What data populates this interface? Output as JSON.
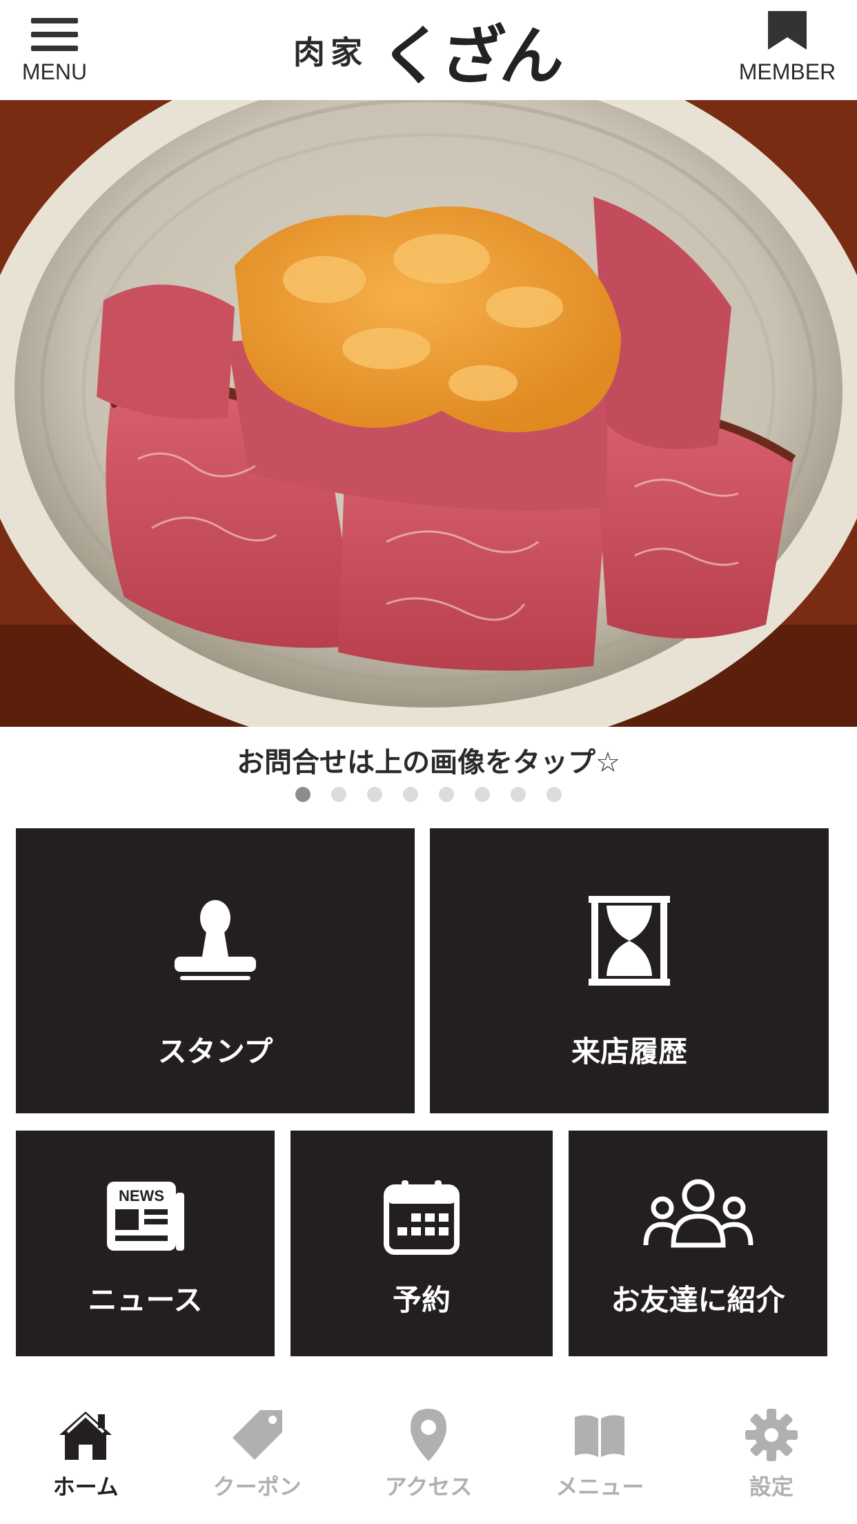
{
  "header": {
    "menu_label": "MENU",
    "member_label": "MEMBER",
    "logo_small": "肉家",
    "logo_big": "くざん"
  },
  "hero": {
    "caption": "お問合せは上の画像をタップ☆",
    "slide_count": 8,
    "active_slide": 1
  },
  "tiles": {
    "stamp": "スタンプ",
    "history": "来店履歴",
    "news": "ニュース",
    "news_icon_text": "NEWS",
    "reserve": "予約",
    "invite": "お友達に紹介"
  },
  "tabs": [
    {
      "label": "ホーム",
      "icon": "home-icon",
      "active": true
    },
    {
      "label": "クーポン",
      "icon": "tag-icon",
      "active": false
    },
    {
      "label": "アクセス",
      "icon": "map-pin-icon",
      "active": false
    },
    {
      "label": "メニュー",
      "icon": "book-icon",
      "active": false
    },
    {
      "label": "設定",
      "icon": "gear-icon",
      "active": false
    }
  ],
  "colors": {
    "tile_bg": "#231f20",
    "tab_active": "#231f20",
    "tab_inactive": "#b0b0b0",
    "dot_active": "#8d8d8d",
    "dot_inactive": "#dcdcdc"
  }
}
